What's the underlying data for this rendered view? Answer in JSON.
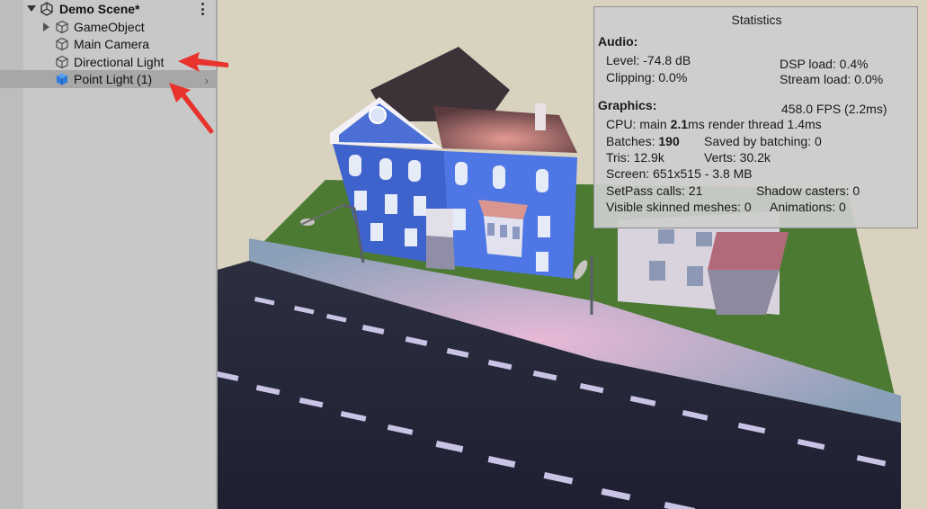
{
  "hierarchy": {
    "scene_name": "Demo Scene*",
    "items": [
      {
        "label": "GameObject",
        "icon": "cube-outline-icon",
        "has_children": true
      },
      {
        "label": "Main Camera",
        "icon": "cube-outline-icon"
      },
      {
        "label": "Directional Light",
        "icon": "cube-outline-icon"
      },
      {
        "label": "Point Light (1)",
        "icon": "cube-blue-icon",
        "selected": true
      }
    ]
  },
  "statistics": {
    "title": "Statistics",
    "audio_header": "Audio:",
    "level": "Level: -74.8 dB",
    "dsp_load": "DSP load: 0.4%",
    "clipping": "Clipping: 0.0%",
    "stream_load": "Stream load: 0.0%",
    "graphics_header": "Graphics:",
    "fps": "458.0 FPS (2.2ms)",
    "cpu_prefix": "CPU: main ",
    "cpu_main": "2.1",
    "cpu_suffix": "ms  render thread 1.4ms",
    "batches_prefix": "Batches: ",
    "batches_value": "190",
    "saved_by_batching": "Saved by batching: 0",
    "tris": "Tris: 12.9k",
    "verts": "Verts: 30.2k",
    "screen": "Screen: 651x515 - 3.8 MB",
    "setpass": "SetPass calls: 21",
    "shadow_casters": "Shadow casters: 0",
    "skinned": "Visible skinned meshes: 0",
    "animations": "Animations: 0"
  },
  "colors": {
    "annotation_arrow": "#e8332c",
    "house_blue": "#3f6fd8",
    "selection": "#a7a7a7"
  }
}
